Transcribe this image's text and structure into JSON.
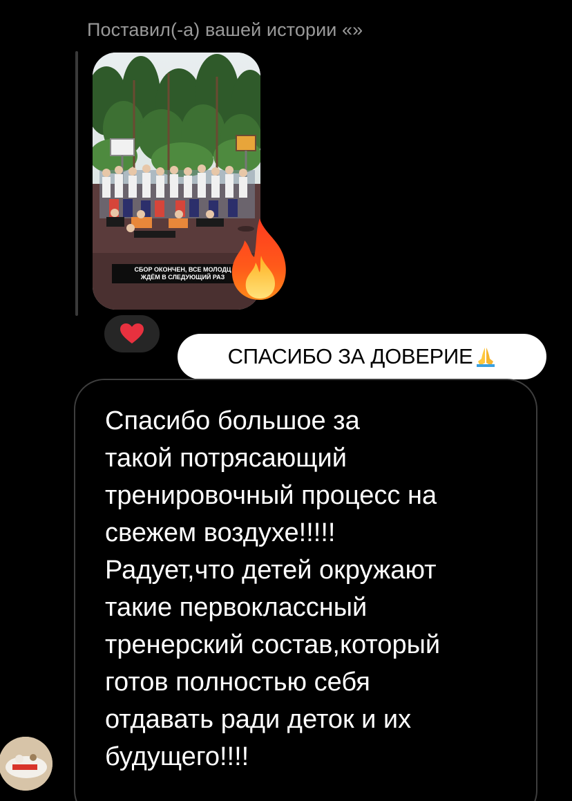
{
  "reply": {
    "header": "Поставил(-а) вашей истории «»"
  },
  "story": {
    "caption_line1": "СБОР ОКОНЧЕН, ВСЕ МОЛОДЦ",
    "caption_line2": "ЖДЁМ В СЛЕДУЮЩИЙ РАЗ",
    "reaction_icon": "fire-icon"
  },
  "sticker": {
    "text": "СПАСИБО ЗА ДОВЕРИЕ",
    "emoji_icon": "praying-hands-icon"
  },
  "heart_reaction": {
    "icon": "heart-icon",
    "color": "#e8313f"
  },
  "message": {
    "text": "Спасибо большое за\nтакой потрясающий\nтренировочный процесс на\nсвежем воздухе!!!!!\nРадует,что детей окружают\nтакие первоклассный\nтренерский состав,который\nготов полностью себя\nотдавать ради деток и их\nбудущего!!!!"
  },
  "colors": {
    "background": "#000000",
    "bubble_border": "#3e3e3e",
    "header_text": "#9a9a9a",
    "sticker_bg": "#ffffff"
  }
}
